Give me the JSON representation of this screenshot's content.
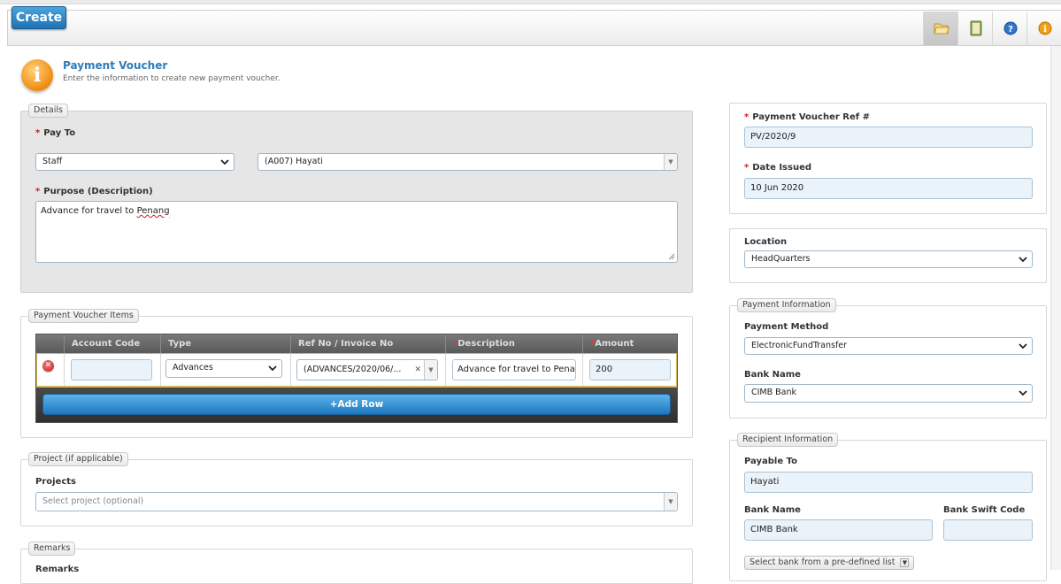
{
  "toolbar": {
    "create_label": "Create",
    "icons": [
      "folder-open-icon",
      "book-icon",
      "help-icon",
      "info-icon"
    ]
  },
  "header": {
    "title": "Payment Voucher",
    "subtitle": "Enter the information to create new payment voucher."
  },
  "details": {
    "legend": "Details",
    "pay_to_label": "Pay To",
    "pay_to_type": "Staff",
    "pay_to_person": "(A007) Hayati",
    "purpose_label": "Purpose (Description)",
    "purpose_text_prefix": "Advance for travel to ",
    "purpose_text_word": "Penang"
  },
  "items": {
    "legend": "Payment Voucher Items",
    "columns": {
      "account_code": "Account Code",
      "type": "Type",
      "ref_no": "Ref No / Invoice No",
      "description": "Description",
      "amount": "Amount"
    },
    "rows": [
      {
        "account_code": "",
        "type": "Advances",
        "ref_no": "(ADVANCES/2020/06/...",
        "description": "Advance for travel to Pena",
        "amount": "200"
      }
    ],
    "add_row_label": "+Add Row"
  },
  "project": {
    "legend": "Project (if applicable)",
    "projects_label": "Projects",
    "projects_placeholder": "Select project (optional)"
  },
  "remarks": {
    "legend": "Remarks",
    "label_partial": "Remarks"
  },
  "voucher": {
    "ref_label": "Payment Voucher Ref #",
    "ref_value": "PV/2020/9",
    "date_label": "Date Issued",
    "date_value": "10 Jun 2020"
  },
  "location": {
    "label": "Location",
    "value": "HeadQuarters"
  },
  "payment_info": {
    "legend": "Payment Information",
    "method_label": "Payment Method",
    "method_value": "ElectronicFundTransfer",
    "bank_label": "Bank Name",
    "bank_value": "CIMB Bank"
  },
  "recipient": {
    "legend": "Recipient Information",
    "payable_label": "Payable To",
    "payable_value": "Hayati",
    "bank_label": "Bank Name",
    "bank_value": "CIMB Bank",
    "swift_label": "Bank Swift Code",
    "swift_value": "",
    "predefined_label": "Select bank from a pre-defined list"
  },
  "colors": {
    "accent": "#2b7db8",
    "required": "#d21c1c",
    "create_button": "#1f72b5"
  }
}
